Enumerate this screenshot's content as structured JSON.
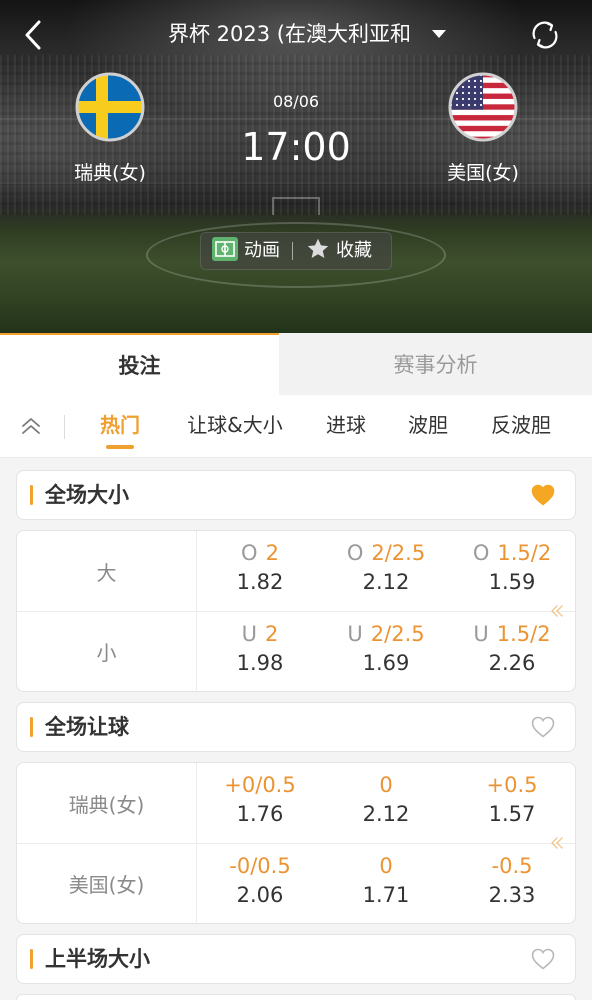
{
  "header": {
    "title": "界杯 2023 (在澳大利亚和",
    "date": "08/06",
    "time": "17:00",
    "home": {
      "name": "瑞典(女)",
      "flag_icon": "sweden-flag-icon"
    },
    "away": {
      "name": "美国(女)",
      "flag_icon": "usa-flag-icon"
    },
    "actions": {
      "animation": "动画",
      "favorite": "收藏"
    },
    "icons": {
      "back": "chevron-left-icon",
      "dropdown": "caret-down-icon",
      "refresh": "refresh-icon",
      "animation": "pitch-icon",
      "favorite": "star-icon"
    }
  },
  "tabs": [
    {
      "label": "投注",
      "active": true
    },
    {
      "label": "赛事分析",
      "active": false
    }
  ],
  "filters": [
    {
      "label": "热门",
      "active": true
    },
    {
      "label": "让球&大小",
      "active": false
    },
    {
      "label": "进球",
      "active": false
    },
    {
      "label": "波胆",
      "active": false
    },
    {
      "label": "反波胆",
      "active": false
    }
  ],
  "markets": [
    {
      "title": "全场大小",
      "favorited": true,
      "rows": [
        {
          "label": "大",
          "cells": [
            {
              "prefix": "O",
              "line": "2",
              "odds": "1.82"
            },
            {
              "prefix": "O",
              "line": "2/2.5",
              "odds": "2.12"
            },
            {
              "prefix": "O",
              "line": "1.5/2",
              "odds": "1.59"
            }
          ]
        },
        {
          "label": "小",
          "cells": [
            {
              "prefix": "U",
              "line": "2",
              "odds": "1.98"
            },
            {
              "prefix": "U",
              "line": "2/2.5",
              "odds": "1.69"
            },
            {
              "prefix": "U",
              "line": "1.5/2",
              "odds": "2.26"
            }
          ]
        }
      ]
    },
    {
      "title": "全场让球",
      "favorited": false,
      "rows": [
        {
          "label": "瑞典(女)",
          "cells": [
            {
              "line": "+0/0.5",
              "odds": "1.76"
            },
            {
              "line": "0",
              "odds": "2.12"
            },
            {
              "line": "+0.5",
              "odds": "1.57"
            }
          ]
        },
        {
          "label": "美国(女)",
          "cells": [
            {
              "line": "-0/0.5",
              "odds": "2.06"
            },
            {
              "line": "0",
              "odds": "1.71"
            },
            {
              "line": "-0.5",
              "odds": "2.33"
            }
          ]
        }
      ]
    },
    {
      "title": "上半场大小",
      "favorited": false
    }
  ],
  "colors": {
    "accent": "#f0a030",
    "odds_line": "#ec9332",
    "favorite_active": "#f5a623"
  }
}
